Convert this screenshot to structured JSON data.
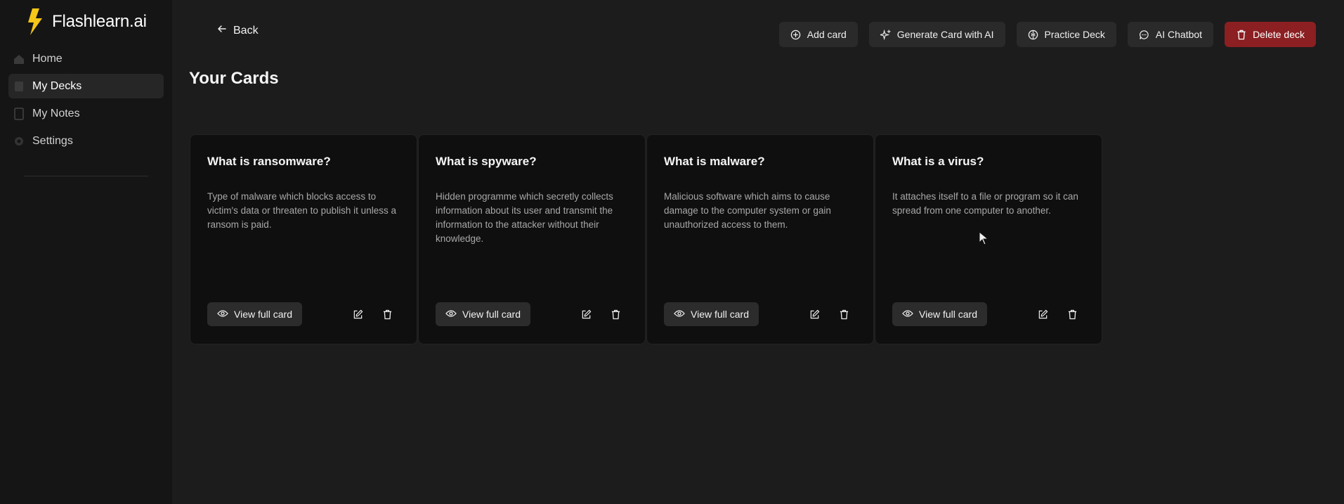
{
  "brand": {
    "name": "Flashlearn.ai",
    "logo_icon": "lightning-bolt-icon",
    "accent": "#f5c518"
  },
  "sidebar": {
    "items": [
      {
        "label": "Home",
        "icon": "home-icon",
        "active": false
      },
      {
        "label": "My Decks",
        "icon": "deck-icon",
        "active": true
      },
      {
        "label": "My Notes",
        "icon": "notebook-icon",
        "active": false
      },
      {
        "label": "Settings",
        "icon": "gear-icon",
        "active": false
      }
    ]
  },
  "header": {
    "back_label": "Back",
    "actions": {
      "add_card": "Add card",
      "generate_ai": "Generate Card with AI",
      "practice_deck": "Practice Deck",
      "ai_chatbot": "AI Chatbot",
      "delete_deck": "Delete deck"
    },
    "danger_color": "#8b1f22"
  },
  "page": {
    "title": "Your Cards"
  },
  "cards": [
    {
      "question": "What is ransomware?",
      "answer": "Type of malware which blocks access to victim's data or threaten to publish it unless a ransom is paid.",
      "view_label": "View full card"
    },
    {
      "question": "What is spyware?",
      "answer": "Hidden programme which secretly collects information about its user and transmit the information to the attacker without their knowledge.",
      "view_label": "View full card"
    },
    {
      "question": "What is malware?",
      "answer": "Malicious software which aims to cause damage to the computer system or gain unauthorized access to them.",
      "view_label": "View full card"
    },
    {
      "question": "What is a virus?",
      "answer": "It attaches itself to a file or program so it can spread from one computer to another.",
      "view_label": "View full card"
    }
  ]
}
